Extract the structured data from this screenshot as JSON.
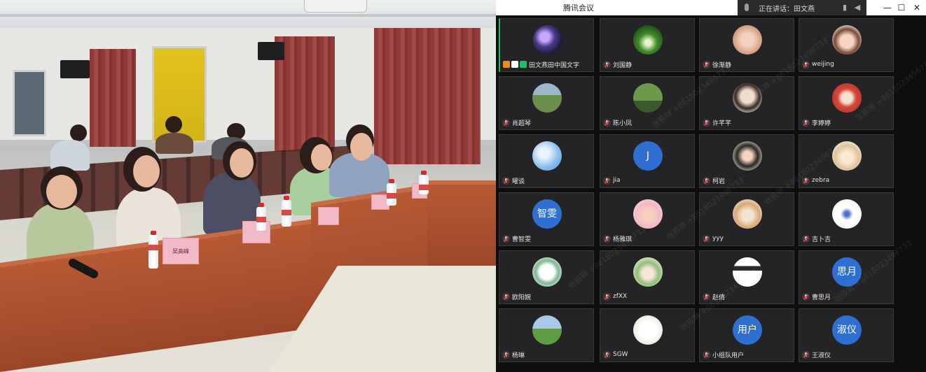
{
  "app": {
    "title": "腾讯会议"
  },
  "speaking": {
    "label": "正在讲话：",
    "name": "田文燕"
  },
  "window_controls": {
    "minimize": "—",
    "maximize": "☐",
    "close": "✕"
  },
  "colors": {
    "active_speaker": "#1fbf6a",
    "tile_bg": "#242426",
    "avatar_blue": "#2f6fd1",
    "mute_red": "#e23b3b"
  },
  "photo": {
    "nameplate_1": "吴高峰"
  },
  "watermark": "张筱琳 +8618023496733",
  "participants": [
    {
      "name": "田文燕田中国文字",
      "avatar": "night-city-photo",
      "host": true
    },
    {
      "name": "刘国静",
      "avatar": "forest-photo"
    },
    {
      "name": "徐渐静",
      "avatar": "cat-photo"
    },
    {
      "name": "weijing",
      "avatar": "girl-photo"
    },
    {
      "name": "肖超琴",
      "avatar": "meadow-photo"
    },
    {
      "name": "陈小凤",
      "avatar": "field-photo"
    },
    {
      "name": "许芊芊",
      "avatar": "woman-photo"
    },
    {
      "name": "李婷婷",
      "avatar": "cartoon-photo"
    },
    {
      "name": "曜谈",
      "avatar": "sky-photo"
    },
    {
      "name": "jia",
      "avatar_text": "J"
    },
    {
      "name": "柯岩",
      "avatar": "portrait-photo"
    },
    {
      "name": "zebra",
      "avatar": "toy-photo"
    },
    {
      "name": "曹智雯",
      "avatar_text": "智雯"
    },
    {
      "name": "杨雅琪",
      "avatar": "child-photo"
    },
    {
      "name": "yyy",
      "avatar": "kitten-photo"
    },
    {
      "name": "吉卜吉",
      "avatar": "robot-photo"
    },
    {
      "name": "欧阳婉",
      "avatar": "sketch-photo"
    },
    {
      "name": "zfXX",
      "avatar": "cartoon-girl-photo"
    },
    {
      "name": "赵倩",
      "avatar": "figure-photo"
    },
    {
      "name": "曹思月",
      "avatar_text": "思月"
    },
    {
      "name": "杨琳",
      "avatar": "landscape-photo"
    },
    {
      "name": "SGW",
      "avatar": "white-photo"
    },
    {
      "name": "小组队用户",
      "avatar_text": "用户"
    },
    {
      "name": "王淑仪",
      "avatar_text": "淑仪"
    }
  ]
}
